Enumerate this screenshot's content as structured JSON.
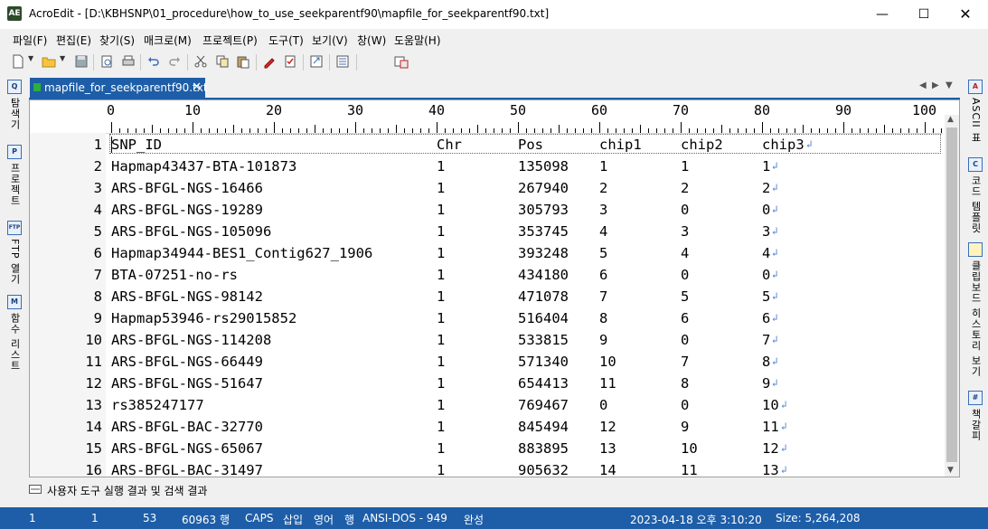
{
  "window": {
    "app_icon_text": "AE",
    "title": "AcroEdit - [D:\\KBHSNP\\01_procedure\\how_to_use_seekparentf90\\mapfile_for_seekparentf90.txt]"
  },
  "menu": [
    "파일(F)",
    "편집(E)",
    "찾기(S)",
    "매크로(M)",
    "프로젝트(P)",
    "도구(T)",
    "보기(V)",
    "창(W)",
    "도움말(H)"
  ],
  "left_panel": [
    {
      "icon": "search-panel-icon",
      "glyph": "Q",
      "label": "탐색기"
    },
    {
      "icon": "project-icon",
      "glyph": "P",
      "label": "프로젝트"
    },
    {
      "icon": "ftp-icon",
      "glyph": "FTP",
      "label": "FTP 열기"
    },
    {
      "icon": "function-list-icon",
      "glyph": "M",
      "label": "함수 리스트"
    }
  ],
  "right_panel": [
    {
      "icon": "ascii-table-icon",
      "glyph": "A",
      "label": "ASCII 표"
    },
    {
      "icon": "code-template-icon",
      "glyph": "C",
      "label": "코드 템플릿"
    },
    {
      "icon": "clipboard-history-icon",
      "glyph": "📋",
      "label": "클립보드 히스토리 보기"
    },
    {
      "icon": "bookmark-icon",
      "glyph": "#",
      "label": "책갈피"
    }
  ],
  "tab": {
    "label": "mapfile_for_seekparentf90.txt",
    "close": "✕"
  },
  "ruler_labels": [
    "0",
    "10",
    "20",
    "30",
    "40",
    "50",
    "60",
    "70",
    "80",
    "90",
    "100"
  ],
  "columns": [
    "SNP_ID",
    "Chr",
    "Pos",
    "chip1",
    "chip2",
    "chip3"
  ],
  "rows": [
    {
      "n": "1",
      "c": [
        "SNP_ID",
        "Chr",
        "Pos",
        "chip1",
        "chip2",
        "chip3"
      ]
    },
    {
      "n": "2",
      "c": [
        "Hapmap43437-BTA-101873",
        "1",
        "135098",
        "1",
        "1",
        "1"
      ]
    },
    {
      "n": "3",
      "c": [
        "ARS-BFGL-NGS-16466",
        "1",
        "267940",
        "2",
        "2",
        "2"
      ]
    },
    {
      "n": "4",
      "c": [
        "ARS-BFGL-NGS-19289",
        "1",
        "305793",
        "3",
        "0",
        "0"
      ]
    },
    {
      "n": "5",
      "c": [
        "ARS-BFGL-NGS-105096",
        "1",
        "353745",
        "4",
        "3",
        "3"
      ]
    },
    {
      "n": "6",
      "c": [
        "Hapmap34944-BES1_Contig627_1906",
        "1",
        "393248",
        "5",
        "4",
        "4"
      ]
    },
    {
      "n": "7",
      "c": [
        "BTA-07251-no-rs",
        "1",
        "434180",
        "6",
        "0",
        "0"
      ]
    },
    {
      "n": "8",
      "c": [
        "ARS-BFGL-NGS-98142",
        "1",
        "471078",
        "7",
        "5",
        "5"
      ]
    },
    {
      "n": "9",
      "c": [
        "Hapmap53946-rs29015852",
        "1",
        "516404",
        "8",
        "6",
        "6"
      ]
    },
    {
      "n": "10",
      "c": [
        "ARS-BFGL-NGS-114208",
        "1",
        "533815",
        "9",
        "0",
        "7"
      ]
    },
    {
      "n": "11",
      "c": [
        "ARS-BFGL-NGS-66449",
        "1",
        "571340",
        "10",
        "7",
        "8"
      ]
    },
    {
      "n": "12",
      "c": [
        "ARS-BFGL-NGS-51647",
        "1",
        "654413",
        "11",
        "8",
        "9"
      ]
    },
    {
      "n": "13",
      "c": [
        "rs385247177",
        "1",
        "769467",
        "0",
        "0",
        "10"
      ]
    },
    {
      "n": "14",
      "c": [
        "ARS-BFGL-BAC-32770",
        "1",
        "845494",
        "12",
        "9",
        "11"
      ]
    },
    {
      "n": "15",
      "c": [
        "ARS-BFGL-NGS-65067",
        "1",
        "883895",
        "13",
        "10",
        "12"
      ]
    },
    {
      "n": "16",
      "c": [
        "ARS-BFGL-BAC-31497",
        "1",
        "905632",
        "14",
        "11",
        "13"
      ]
    }
  ],
  "output_bar": {
    "label": "사용자 도구 실행 결과 및 검색 결과"
  },
  "status": {
    "line": "1",
    "col": "1",
    "col2": "53",
    "lines": "60963 행",
    "caps": "CAPS",
    "insert": "삽입",
    "lang": "영어",
    "row_mode": "행",
    "encoding": "ANSI-DOS - 949",
    "state": "완성",
    "datetime": "2023-04-18 오후 3:10:20",
    "size": "Size: 5,264,208"
  },
  "colors": {
    "accent": "#1e5ea8",
    "eol": "#4a7fd0"
  }
}
